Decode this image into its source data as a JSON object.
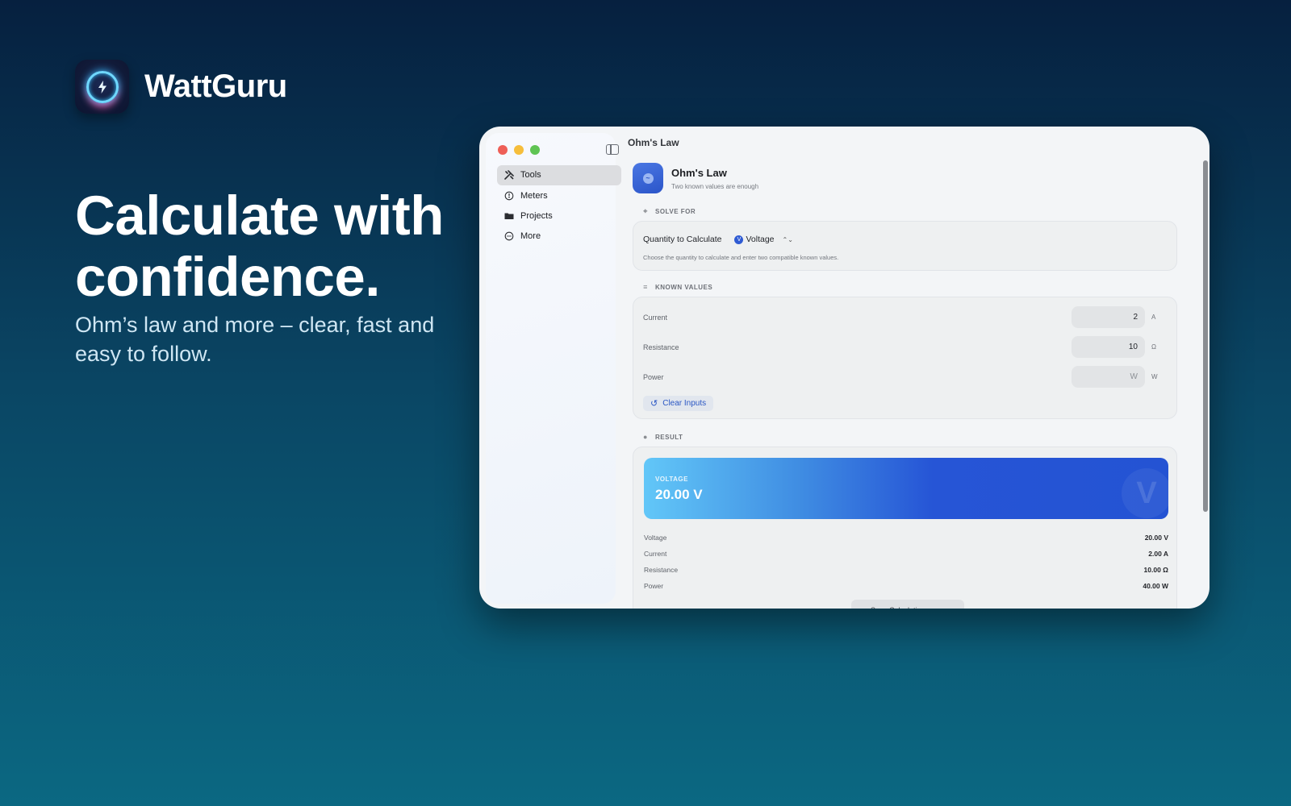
{
  "brand": {
    "name": "WattGuru",
    "icon": "lightning-bolt-icon"
  },
  "headline": {
    "line1": "Calculate with",
    "line2": "confidence."
  },
  "subline": "Ohm’s law and more – clear, fast and easy to follow.",
  "colors": {
    "accent": "#2f5bd3",
    "link": "#2b57c4",
    "background_top": "#06203f",
    "background_bottom": "#0b6882"
  },
  "window": {
    "title": "Ohm's Law",
    "sidebar": {
      "items": [
        {
          "label": "Tools",
          "icon": "tools-icon",
          "active": true
        },
        {
          "label": "Meters",
          "icon": "gauge-icon",
          "active": false
        },
        {
          "label": "Projects",
          "icon": "folder-icon",
          "active": false
        },
        {
          "label": "More",
          "icon": "ellipsis-circle-icon",
          "active": false
        }
      ]
    },
    "header": {
      "title": "Ohm's Law",
      "subtitle": "Two known values are enough"
    },
    "solve_for": {
      "section_label": "SOLVE FOR",
      "quantity_label": "Quantity to Calculate",
      "selected": "Voltage",
      "selected_badge": "V",
      "help": "Choose the quantity to calculate and enter two compatible known values."
    },
    "known_values": {
      "section_label": "KNOWN VALUES",
      "fields": [
        {
          "label": "Current",
          "value": "2",
          "placeholder": "A",
          "unit": "A"
        },
        {
          "label": "Resistance",
          "value": "10",
          "placeholder": "Ω",
          "unit": "Ω"
        },
        {
          "label": "Power",
          "value": "",
          "placeholder": "W",
          "unit": "W"
        }
      ],
      "clear_label": "Clear Inputs"
    },
    "result": {
      "section_label": "RESULT",
      "hero_label": "VOLTAGE",
      "hero_value": "20.00 V",
      "hero_mark": "V",
      "rows": [
        {
          "label": "Voltage",
          "value": "20.00 V"
        },
        {
          "label": "Current",
          "value": "2.00 A"
        },
        {
          "label": "Resistance",
          "value": "10.00 Ω"
        },
        {
          "label": "Power",
          "value": "40.00 W"
        }
      ],
      "save_label": "Save Calculation"
    }
  }
}
